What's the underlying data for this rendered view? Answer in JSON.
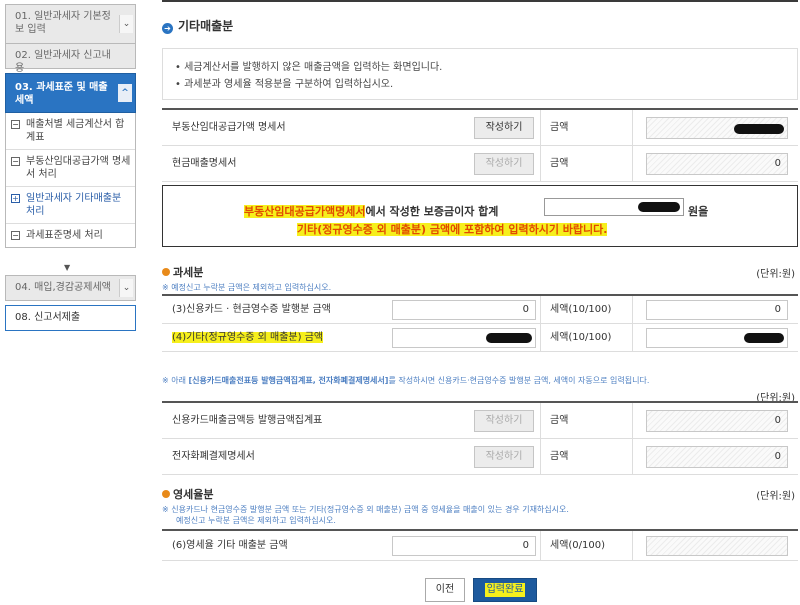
{
  "sidebar": {
    "items": [
      {
        "label": "01. 일반과세자 기본정보 입력"
      },
      {
        "label": "02. 일반과세자 신고내용"
      },
      {
        "label": "03. 과세표준 및 매출세액"
      },
      {
        "label": "04. 매입,경감공제세액"
      },
      {
        "label": "08. 신고서제출"
      }
    ],
    "sub_items": [
      {
        "label": "매출처별 세금계산서 합계표",
        "mark": "−"
      },
      {
        "label": "부동산임대공급가액 명세서 처리",
        "mark": "−"
      },
      {
        "label": "일반과세자 기타매출분 처리",
        "mark": "+"
      },
      {
        "label": "과세표준명세 처리",
        "mark": "−"
      }
    ]
  },
  "main": {
    "title": "기타매출분",
    "notices": [
      "• 세금계산서를 발행하지 않은 매출금액을 입력하는 화면입니다.",
      "• 과세분과 영세율 적용분을 구분하여 입력하십시오."
    ],
    "rows_top": [
      {
        "label": "부동산임대공급가액 명세서",
        "button": "작성하기",
        "amount_label": "금액",
        "value": ""
      },
      {
        "label": "현금매출명세서",
        "button": "작성하기",
        "amount_label": "금액",
        "value": "0"
      }
    ],
    "info": {
      "highlight_doc": "부동산임대공급가액명세서",
      "line1_mid": "에서 작성한 보증금이자 합계",
      "line1_end": "원을",
      "line2": "기타(정규영수증 외 매출분) 금액에 포함하여 입력하시기 바랍니다."
    },
    "taxable": {
      "heading": "과세분",
      "unit": "(단위:원)",
      "note": "※ 예정신고 누락분 금액은 제외하고 입력하십시오.",
      "rows": [
        {
          "label": "(3)신용카드 · 현금영수증 발행분 금액",
          "value": "0",
          "tax_label": "세액(10/100)",
          "tax_value": "0"
        },
        {
          "label": "(4)기타(정규영수증 외 매출분) 금액",
          "value": "",
          "tax_label": "세액(10/100)",
          "tax_value": ""
        }
      ]
    },
    "card_note": {
      "prefix": "※ 아래 ",
      "bold": "[신용카드매출전표등 발행금액집계표, 전자화폐결제명세서]",
      "suffix": "를 작성하시면 신용카드·현금영수증 발행분 금액, 세액이 자동으로 입력됩니다."
    },
    "card_unit": "(단위:원)",
    "card_rows": [
      {
        "label": "신용카드매출금액등 발행금액집계표",
        "button": "작성하기",
        "amount_label": "금액",
        "value": "0"
      },
      {
        "label": "전자화폐결제명세서",
        "button": "작성하기",
        "amount_label": "금액",
        "value": "0"
      }
    ],
    "zero_rated": {
      "heading": "영세율분",
      "unit": "(단위:원)",
      "note1": "※ 신용카드나 현금영수증 발행분 금액 또는 기타(정규영수증 외 매출분) 금액 중 영세율을 매출이 있는 경우 기재하십시오.",
      "note2": "예정신고 누락분 금액은 제외하고 입력하십시오.",
      "row": {
        "label": "(6)영세율 기타 매출분 금액",
        "value": "0",
        "tax_label": "세액(0/100)",
        "tax_value": ""
      }
    },
    "buttons": {
      "prev": "이전",
      "done": "입력완료"
    }
  }
}
